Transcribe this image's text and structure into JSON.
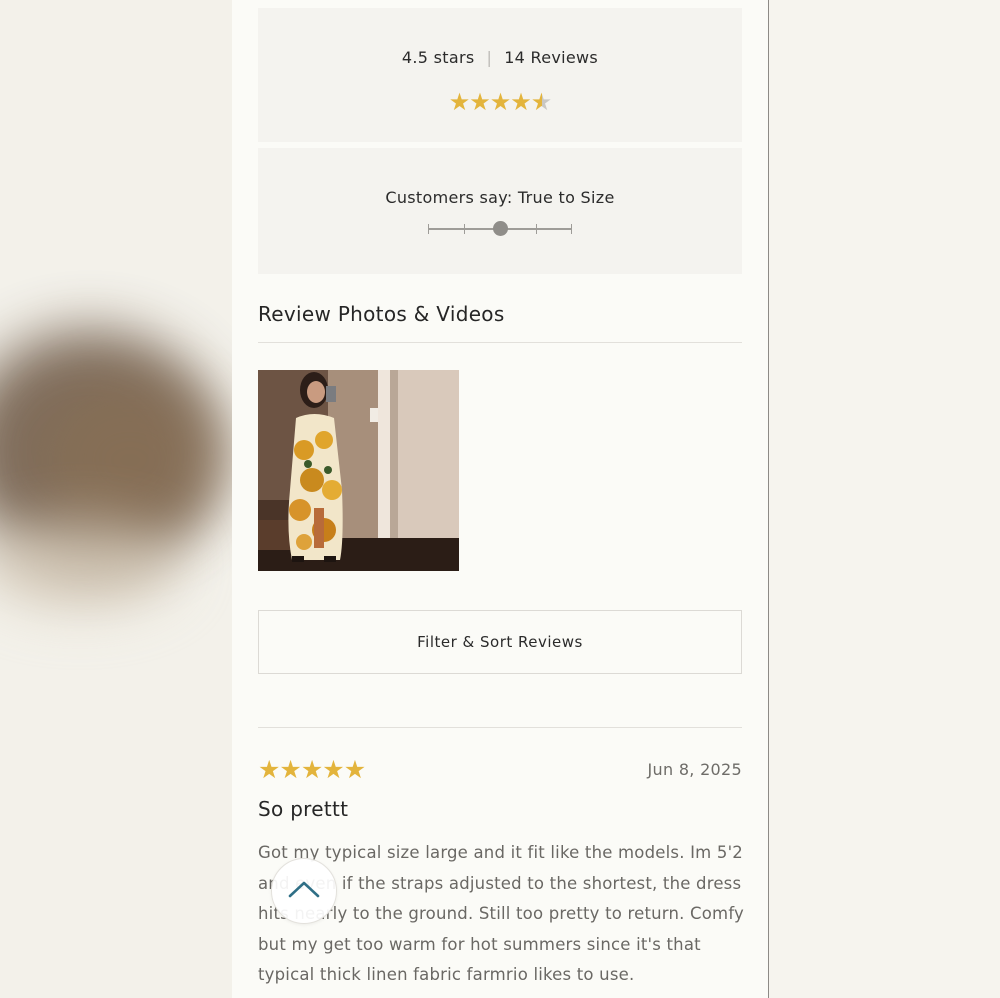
{
  "rating": {
    "stars_text": "4.5 stars",
    "reviews_text": "14 Reviews",
    "value": 4.5,
    "max": 5
  },
  "fit": {
    "label": "Customers say: True to Size",
    "position": 0.5
  },
  "photos": {
    "title": "Review Photos & Videos"
  },
  "filter": {
    "label": "Filter & Sort Reviews"
  },
  "review": {
    "stars": 5,
    "date": "Jun 8, 2025",
    "title": "So prettt",
    "body": "Got my typical size large and it fit like the models. Im 5'2 and even if the straps adjusted to the shortest, the dress hits nearly to the ground. Still too pretty to return. Comfy but my get too warm for hot summers since it's that typical thick linen fabric farmrio likes to use."
  },
  "colors": {
    "star": "#e3b43c",
    "star_empty": "#c9c7c3",
    "back_to_top_icon": "#2f6f86"
  },
  "icons": {
    "back_to_top": "chevron-up-icon"
  }
}
